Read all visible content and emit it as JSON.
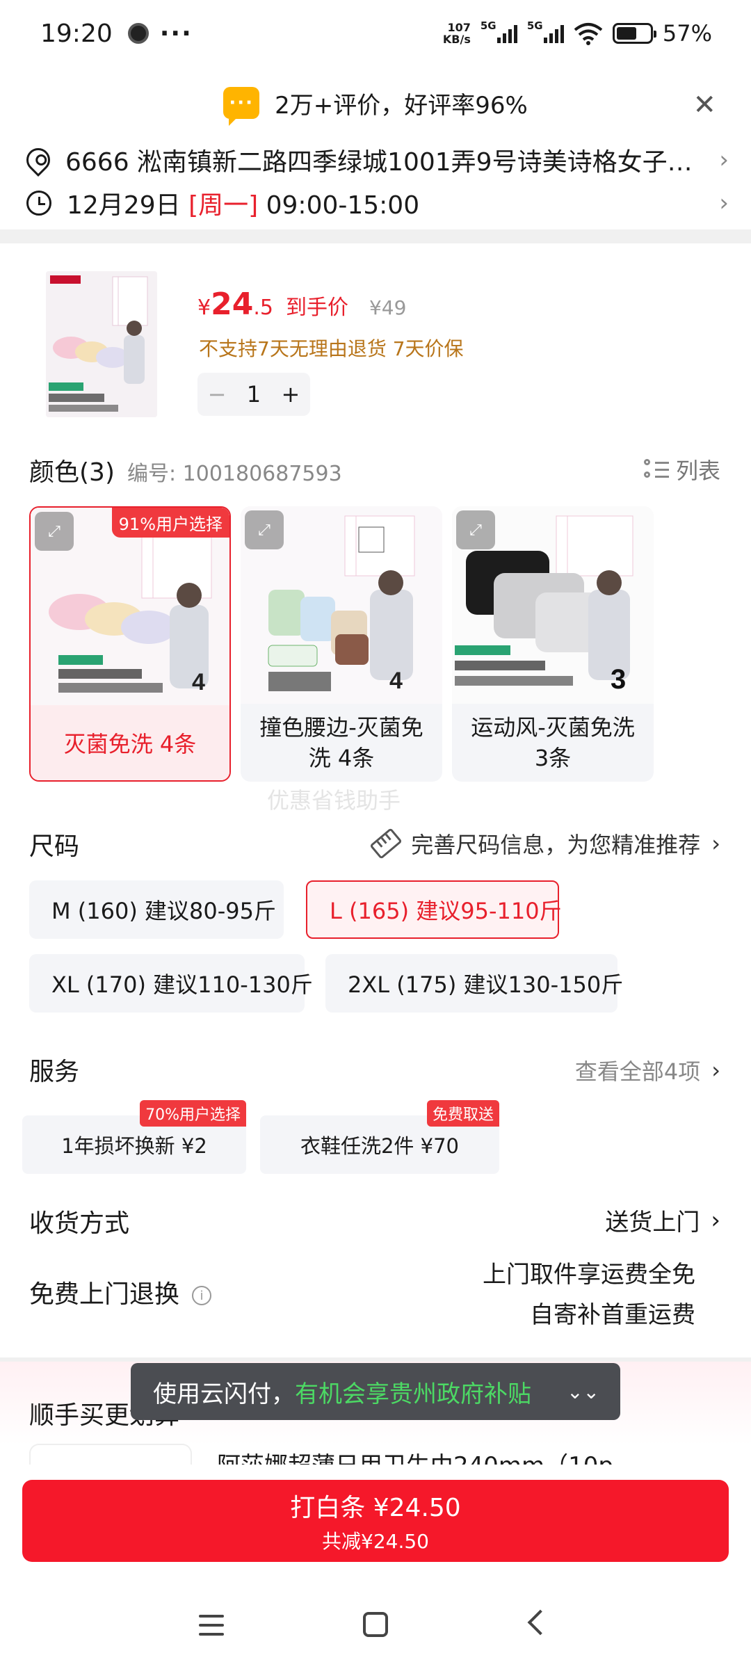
{
  "status_bar": {
    "time": "19:20",
    "more": "···",
    "net_speed_value": "107",
    "net_speed_unit": "KB/s",
    "sim1": "5G",
    "sim2": "5G",
    "battery": "57%"
  },
  "review_banner": {
    "icon": "chat-bubble-icon",
    "text": "2万+评价，好评率96%"
  },
  "address": {
    "text": "6666  淞南镇新二路四季绿城1001弄9号诗美诗格女子…",
    "delivery_date": "12月29日",
    "delivery_weekday": "[周一]",
    "delivery_time": "09:00-15:00"
  },
  "product": {
    "price_symbol": "¥",
    "price_int": "24",
    "price_dec": ".5",
    "price_tag": "到手价",
    "original_price": "¥49",
    "policy": "不支持7天无理由退货  7天价保",
    "quantity": "1",
    "minus": "−",
    "plus": "+"
  },
  "color_section": {
    "title": "颜色(3)",
    "sku": "编号: 100180687593",
    "list_label": "列表",
    "options": [
      {
        "label": "灭菌免洗 4条",
        "badge": "91%用户选择",
        "selected": true
      },
      {
        "label": "撞色腰边-灭菌免洗 4条",
        "selected": false
      },
      {
        "label": "运动风-灭菌免洗3条",
        "selected": false
      }
    ],
    "watermark": "优惠省钱助手"
  },
  "size_section": {
    "title": "尺码",
    "hint": "完善尺码信息，为您精准推荐",
    "options": [
      {
        "label": "M (160) 建议80-95斤",
        "selected": false
      },
      {
        "label": "L (165) 建议95-110斤",
        "selected": true
      },
      {
        "label": "XL (170) 建议110-130斤",
        "selected": false
      },
      {
        "label": "2XL (175) 建议130-150斤",
        "selected": false
      }
    ]
  },
  "service_section": {
    "title": "服务",
    "view_all": "查看全部4项",
    "options": [
      {
        "label": "1年损坏换新  ¥2",
        "badge": "70%用户选择"
      },
      {
        "label": "衣鞋任洗2件  ¥70",
        "badge": "免费取送"
      }
    ]
  },
  "delivery_section": {
    "title": "收货方式",
    "value": "送货上门"
  },
  "refund_section": {
    "title": "免费上门退换",
    "line1": "上门取件享运费全免",
    "line2": "自寄补首重运费"
  },
  "recommend": {
    "title": "顺手买更划算",
    "item_name": "阿莎娜超薄日用卫生巾240mm（10p"
  },
  "toast": {
    "prefix": "使用云闪付，",
    "highlight": "有机会享贵州政府补贴"
  },
  "buy_button": {
    "label": "打白条 ¥24.50",
    "discount": "共减¥24.50"
  },
  "colors": {
    "accent_red": "#e8202c",
    "button_red": "#f5182a",
    "policy_orange": "#b8751a",
    "toast_green": "#4cd964"
  }
}
